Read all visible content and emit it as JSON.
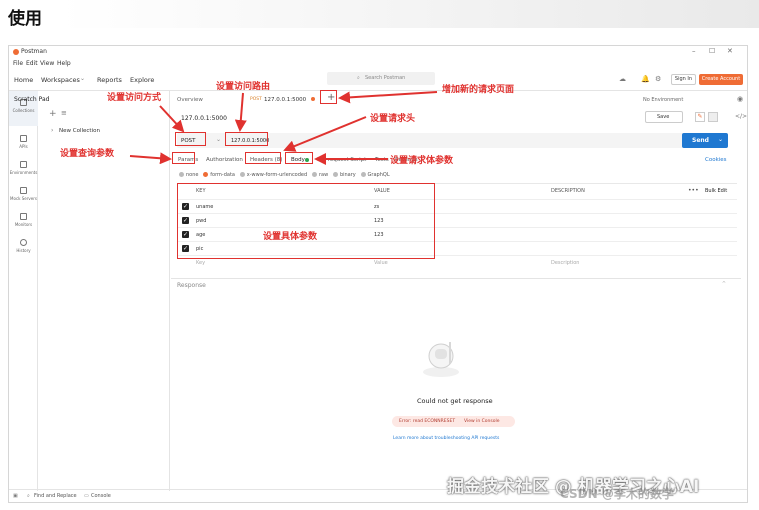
{
  "page": {
    "heading": "使用"
  },
  "app": {
    "title": "Postman",
    "menu": [
      "File",
      "Edit",
      "View",
      "Help"
    ],
    "nav": {
      "home": "Home",
      "workspaces": "Workspaces",
      "reports": "Reports",
      "explore": "Explore"
    },
    "search_placeholder": "Search Postman",
    "sign_in": "Sign In",
    "create_account": "Create Account",
    "window_controls": {
      "minimize": "–",
      "maximize": "☐",
      "close": "✕"
    }
  },
  "scratch": {
    "label": "Scratch Pad",
    "new_collection": "New Collection"
  },
  "sidebar": {
    "items": [
      {
        "label": "Collections",
        "icon": "collections-icon"
      },
      {
        "label": "APIs",
        "icon": "apis-icon"
      },
      {
        "label": "Environments",
        "icon": "environments-icon"
      },
      {
        "label": "Mock Servers",
        "icon": "mock-servers-icon"
      },
      {
        "label": "Monitors",
        "icon": "monitors-icon"
      },
      {
        "label": "History",
        "icon": "history-icon"
      }
    ]
  },
  "tabs": {
    "overview": "Overview",
    "current_tab": "127.0.0.1:5000",
    "current_method": "POST",
    "add": "+",
    "environment": "No Environment"
  },
  "request": {
    "title": "127.0.0.1:5000",
    "save": "Save",
    "method": "POST",
    "url": "127.0.0.1:5000",
    "send": "Send",
    "cookies": "Cookies",
    "subtabs": {
      "params": "Params",
      "authorization": "Authorization",
      "headers": "Headers (8)",
      "body": "Body",
      "pre": "Pre-request Script",
      "tests": "Tests",
      "settings": "Settings"
    },
    "body_types": [
      "none",
      "form-data",
      "x-www-form-urlencoded",
      "raw",
      "binary",
      "GraphQL"
    ],
    "table": {
      "headers": {
        "key": "KEY",
        "value": "VALUE",
        "description": "DESCRIPTION",
        "bulk": "Bulk Edit"
      },
      "rows": [
        {
          "key": "uname",
          "value": "zs"
        },
        {
          "key": "pwd",
          "value": "123"
        },
        {
          "key": "age",
          "value": "123"
        },
        {
          "key": "pic",
          "value": ""
        }
      ],
      "placeholder": {
        "key": "Key",
        "value": "Value",
        "description": "Description"
      }
    }
  },
  "response": {
    "label": "Response",
    "empty": "Could not get response",
    "error": "Error: read ECONNRESET",
    "console_link": "View in Console",
    "learn_more": "Learn more about troubleshooting API requests"
  },
  "status": {
    "find": "Find and Replace",
    "console": "Console"
  },
  "annotations": {
    "method": "设置访问方式",
    "route": "设置访问路由",
    "new_page": "增加新的请求页面",
    "headers": "设置请求头",
    "query": "设置查询参数",
    "body_params": "设置请求体参数",
    "body_data": "设置具体参数"
  },
  "watermark": {
    "main": "掘金技术社区 @ 机器学习之心AI",
    "csdn": "CSDN @李木的数学"
  },
  "colors": {
    "accent": "#ef6c35",
    "send": "#1f78d1",
    "annotation": "#e0322f"
  }
}
